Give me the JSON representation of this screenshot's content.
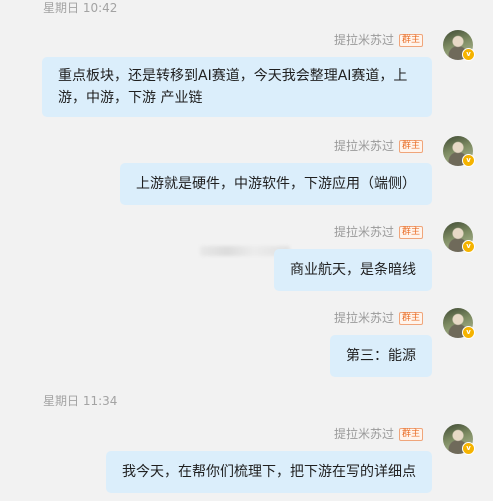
{
  "timestamps": [
    "星期日 10:42",
    "星期日 11:34"
  ],
  "sender": {
    "name": "提拉米苏过",
    "badge": "群主"
  },
  "messages": [
    {
      "text": "重点板块，还是转移到AI赛道，今天我会整理AI赛道，上游，中游，下游 产业链"
    },
    {
      "text": "上游就是硬件，中游软件，下游应用（端侧）"
    },
    {
      "text": "商业航天，是条暗线"
    },
    {
      "text": "第三：能源"
    },
    {
      "text": "我今天，在帮你们梳理下，把下游在写的详细点"
    }
  ],
  "colors": {
    "background": "#f2f2f2",
    "bubble": "#dbeefb",
    "badge": "#e96f2a",
    "verified": "#f5b300"
  },
  "icons": {
    "verified": "v-verified-icon"
  }
}
